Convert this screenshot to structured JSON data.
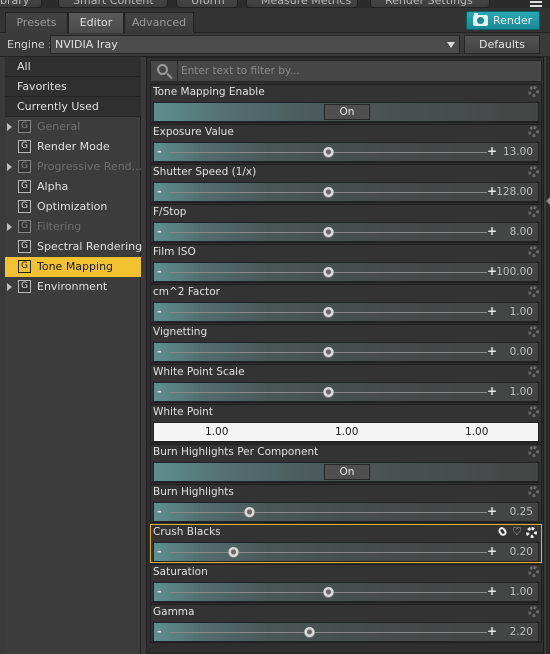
{
  "top_tabs": [
    "ibrary",
    "Smart Content",
    "Uform",
    "Measure Metrics",
    "Render Settings"
  ],
  "sub_tabs": [
    "Presets",
    "Editor",
    "Advanced"
  ],
  "render_button": "Render",
  "engine_label": "Engine :",
  "engine_value": "NVIDIA Iray",
  "defaults_button": "Defaults",
  "filter_placeholder": "Enter text to filter by...",
  "sidebar": {
    "top_items": [
      "All",
      "Favorites",
      "Currently Used"
    ],
    "groups": [
      {
        "label": "General",
        "expandable": true,
        "dim": true,
        "active": false
      },
      {
        "label": "Render Mode",
        "expandable": false,
        "dim": false,
        "active": false
      },
      {
        "label": "Progressive Rend...",
        "expandable": true,
        "dim": true,
        "active": false
      },
      {
        "label": "Alpha",
        "expandable": false,
        "dim": false,
        "active": false
      },
      {
        "label": "Optimization",
        "expandable": false,
        "dim": false,
        "active": false
      },
      {
        "label": "Filtering",
        "expandable": true,
        "dim": true,
        "active": false
      },
      {
        "label": "Spectral Rendering",
        "expandable": false,
        "dim": false,
        "active": false
      },
      {
        "label": "Tone Mapping",
        "expandable": false,
        "dim": false,
        "active": true
      },
      {
        "label": "Environment",
        "expandable": true,
        "dim": false,
        "active": false
      }
    ],
    "group_badge": "G"
  },
  "properties": [
    {
      "name": "Tone Mapping Enable",
      "kind": "toggle",
      "value": "On"
    },
    {
      "name": "Exposure Value",
      "kind": "slider",
      "value": "13.00",
      "pos": 0.5
    },
    {
      "name": "Shutter Speed (1/x)",
      "kind": "slider",
      "value": "128.00",
      "pos": 0.5
    },
    {
      "name": "F/Stop",
      "kind": "slider",
      "value": "8.00",
      "pos": 0.5
    },
    {
      "name": "Film ISO",
      "kind": "slider",
      "value": "100.00",
      "pos": 0.5
    },
    {
      "name": "cm^2 Factor",
      "kind": "slider",
      "value": "1.00",
      "pos": 0.5
    },
    {
      "name": "Vignetting",
      "kind": "slider",
      "value": "0.00",
      "pos": 0.5
    },
    {
      "name": "White Point Scale",
      "kind": "slider",
      "value": "1.00",
      "pos": 0.5
    },
    {
      "name": "White Point",
      "kind": "color",
      "values": [
        "1.00",
        "1.00",
        "1.00"
      ]
    },
    {
      "name": "Burn Highlights Per Component",
      "kind": "toggle",
      "value": "On"
    },
    {
      "name": "Burn Highlights",
      "kind": "slider",
      "value": "0.25",
      "pos": 0.25
    },
    {
      "name": "Crush Blacks",
      "kind": "slider",
      "value": "0.20",
      "pos": 0.2,
      "selected": true
    },
    {
      "name": "Saturation",
      "kind": "slider",
      "value": "1.00",
      "pos": 0.5
    },
    {
      "name": "Gamma",
      "kind": "slider",
      "value": "2.20",
      "pos": 0.44
    }
  ],
  "colors": {
    "accent": "#f2c230",
    "render_button": "#1fa0ac"
  }
}
